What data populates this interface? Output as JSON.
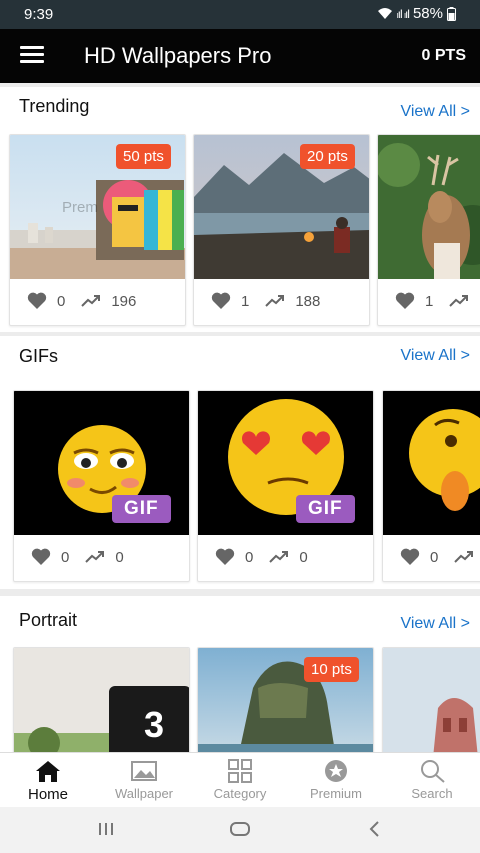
{
  "status_bar": {
    "time": "9:39",
    "signal": "ₗıl ₗıl",
    "battery": "58%"
  },
  "app_bar": {
    "title": "HD Wallpapers Pro",
    "points": "0 PTS"
  },
  "sections": {
    "trending": {
      "title": "Trending",
      "view_all": "View All >",
      "watermark": "Prem",
      "cards": [
        {
          "badge": "50 pts",
          "likes": "0",
          "trend": "196"
        },
        {
          "badge": "20 pts",
          "likes": "1",
          "trend": "188"
        },
        {
          "likes": "1"
        }
      ]
    },
    "gifs": {
      "title": "GIFs",
      "view_all": "View All >",
      "cards": [
        {
          "badge": "GIF",
          "likes": "0",
          "trend": "0"
        },
        {
          "badge": "GIF",
          "likes": "0",
          "trend": "0"
        },
        {
          "likes": "0"
        }
      ]
    },
    "portrait": {
      "title": "Portrait",
      "view_all": "View All >",
      "cards": [
        {
          "overlay_text": "3"
        },
        {
          "badge": "10 pts"
        },
        {}
      ]
    }
  },
  "bottom_nav": [
    {
      "label": "Home",
      "icon": "home-icon",
      "active": true
    },
    {
      "label": "Wallpaper",
      "icon": "image-icon",
      "active": false
    },
    {
      "label": "Category",
      "icon": "grid-icon",
      "active": false
    },
    {
      "label": "Premium",
      "icon": "star-badge-icon",
      "active": false
    },
    {
      "label": "Search",
      "icon": "search-icon",
      "active": false
    }
  ],
  "colors": {
    "accent": "#1a73c9",
    "badge": "#f0522c",
    "gif_badge": "#9b5bbf",
    "app_bar": "#050505",
    "status_bar": "#263238"
  }
}
